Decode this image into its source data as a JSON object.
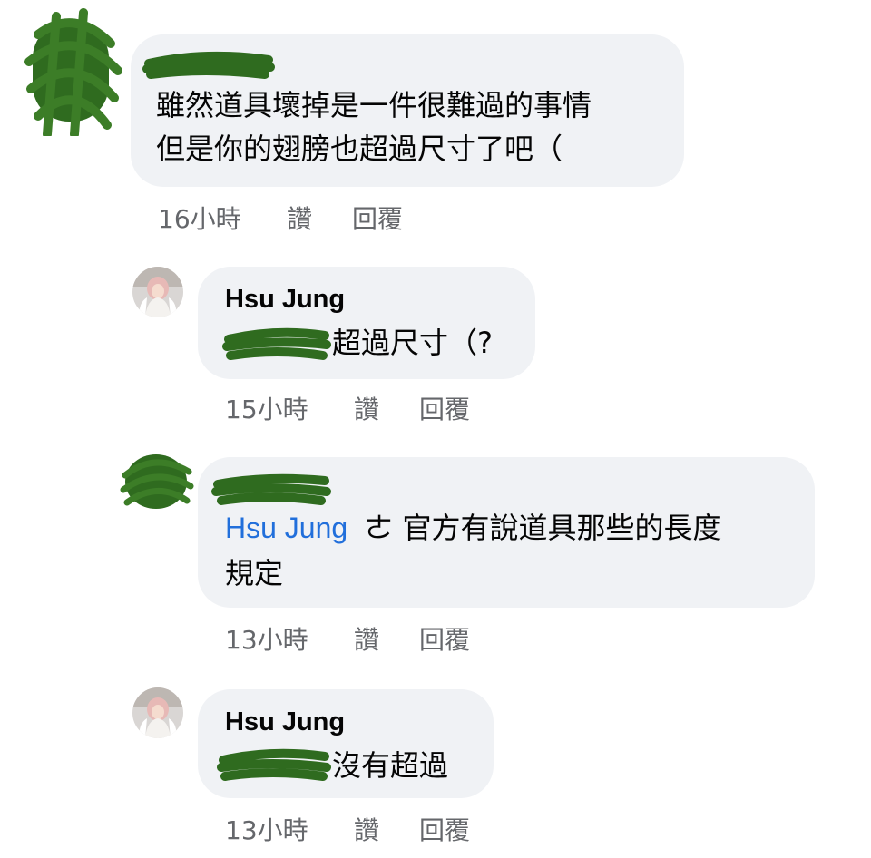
{
  "colors": {
    "bubble_bg": "#f0f2f5",
    "meta_text": "#65676b",
    "mention_blue": "#216fdb",
    "redaction_green": "#2f6b1f"
  },
  "comments": [
    {
      "author_redacted": true,
      "line1": "雖然道具壞掉是一件很難過的事情",
      "line2": "但是你的翅膀也超過尺寸了吧（",
      "time": "16小時",
      "like": "讚",
      "reply": "回覆"
    },
    {
      "author": "Hsu Jung",
      "mention_redacted": true,
      "text": "超過尺寸（?",
      "time": "15小時",
      "like": "讚",
      "reply": "回覆"
    },
    {
      "author_redacted": true,
      "mention": "Hsu Jung",
      "text_line1": "ㄜ 官方有說道具那些的長度",
      "text_line2": "規定",
      "time": "13小時",
      "like": "讚",
      "reply": "回覆"
    },
    {
      "author": "Hsu Jung",
      "mention_redacted": true,
      "text": "沒有超過",
      "time": "13小時",
      "like": "讚",
      "reply": "回覆"
    }
  ]
}
